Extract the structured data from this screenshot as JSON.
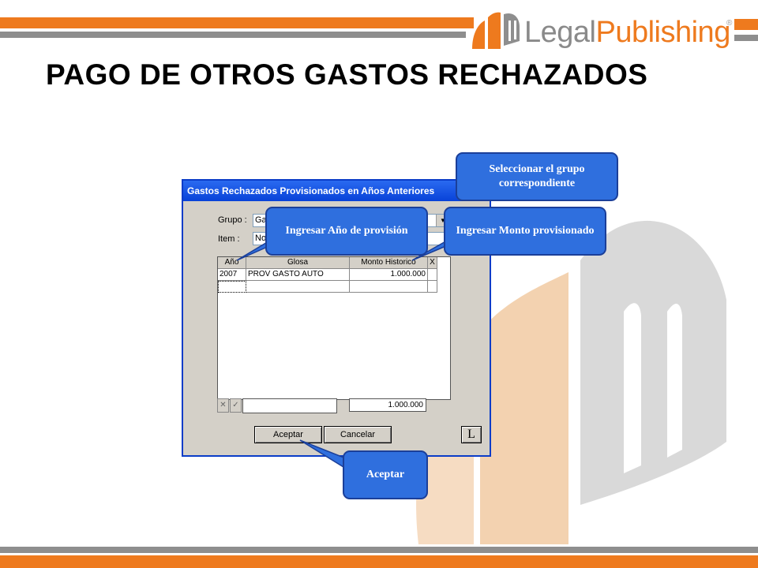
{
  "brand": {
    "part1": "Legal",
    "part2": "Publishing",
    "registered": "®"
  },
  "title": "PAGO DE OTROS GASTOS RECHAZADOS",
  "dialog": {
    "window_title": "Gastos Rechazados Provisionados en Años Anteriores",
    "grupo_label": "Grupo :",
    "grupo_value": "Ga",
    "item_label": "Item :",
    "item_value": "No",
    "columns": [
      "Año",
      "Glosa",
      "Monto Historico",
      "X"
    ],
    "rows": [
      {
        "anio": "2007",
        "glosa": "PROV GASTO AUTO",
        "monto": "1.000.000",
        "x": ""
      }
    ],
    "cancel_small": "✕",
    "check_small": "✓",
    "total": "1.000.000",
    "accept_label": "Aceptar",
    "cancel_label": "Cancelar",
    "l_label": "L"
  },
  "callouts": {
    "grupo": "Seleccionar el grupo correspondiente",
    "anio": "Ingresar Año de provisión",
    "monto": "Ingresar Monto provisionado",
    "aceptar": "Aceptar"
  },
  "colors": {
    "orange": "#ee7a1e",
    "gray": "#8e8e8e",
    "callout_blue": "#2f6fde",
    "titlebar_blue": "#0a3cc8"
  }
}
